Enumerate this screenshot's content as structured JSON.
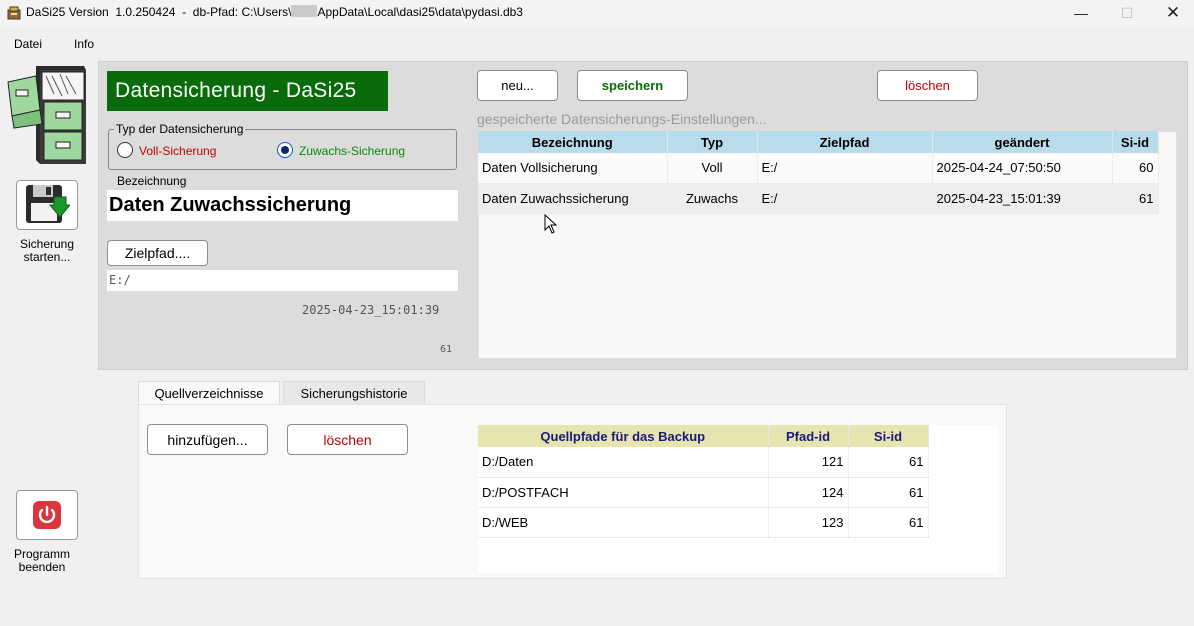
{
  "window": {
    "title_prefix": "DaSi25 Version  1.0.250424  -  db-Pfad: C:\\Users\\",
    "title_suffix": "AppData\\Local\\dasi25\\data\\pydasi.db3",
    "minimize_symbol": "—",
    "maximize_symbol": "☐",
    "close_symbol": "✕"
  },
  "menu": {
    "items": [
      "Datei",
      "Info"
    ]
  },
  "sidebar": {
    "start_backup_label_line1": "Sicherung",
    "start_backup_label_line2": "starten...",
    "quit_label_line1": "Programm",
    "quit_label_line2": "beenden"
  },
  "brand": {
    "title": "Datensicherung - DaSi25",
    "color": "#0a6b0a"
  },
  "backup_type": {
    "group_title": "Typ der Datensicherung",
    "full_label": "Voll-Sicherung",
    "incremental_label": "Zuwachs-Sicherung",
    "selected": "incremental",
    "full_color": "#c00000",
    "incremental_color": "#0a8a0a"
  },
  "form": {
    "name_label": "Bezeichnung",
    "name_value": "Daten Zuwachssicherung",
    "target_button": "Zielpfad....",
    "target_value": "E:/",
    "changed_value": "2025-04-23_15:01:39",
    "id_value": "61"
  },
  "toolbar": {
    "new_label": "neu...",
    "save_label": "speichern",
    "delete_label": "löschen",
    "save_color": "#0a6b0a",
    "delete_color": "#c00000"
  },
  "saved_settings": {
    "caption": "gespeicherte Datensicherungs-Einstellungen...",
    "columns": [
      "Bezeichnung",
      "Typ",
      "Zielpfad",
      "geändert",
      "Si-id"
    ],
    "rows": [
      [
        "Daten Vollsicherung",
        "Voll",
        "E:/",
        "2025-04-24_07:50:50",
        "60"
      ],
      [
        "Daten Zuwachssicherung",
        "Zuwachs",
        "E:/",
        "2025-04-23_15:01:39",
        "61"
      ]
    ]
  },
  "tabs": {
    "items": [
      "Quellverzeichnisse",
      "Sicherungshistorie"
    ],
    "active": 0
  },
  "sources": {
    "add_label": "hinzufügen...",
    "delete_label": "löschen",
    "columns": [
      "Quellpfade für das Backup",
      "Pfad-id",
      "Si-id"
    ],
    "rows": [
      [
        "D:/Daten",
        "121",
        "61"
      ],
      [
        "D:/POSTFACH",
        "124",
        "61"
      ],
      [
        "D:/WEB",
        "123",
        "61"
      ]
    ]
  }
}
